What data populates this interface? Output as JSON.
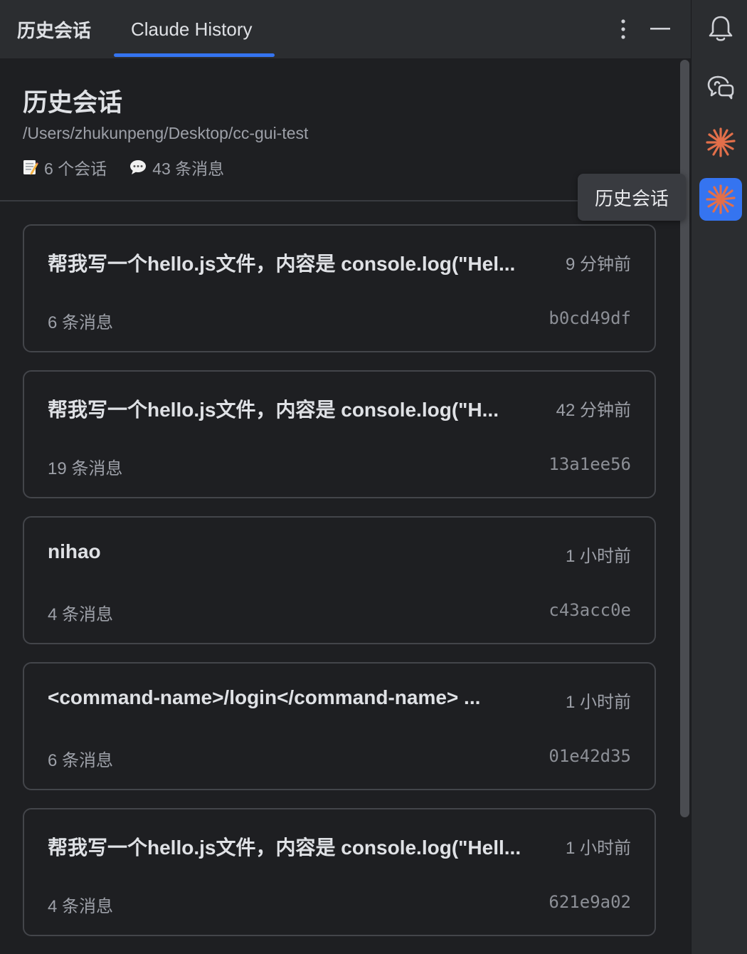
{
  "tabs": [
    {
      "label": "历史会话"
    },
    {
      "label": "Claude History"
    }
  ],
  "header": {
    "title": "历史会话",
    "path": "/Users/zhukunpeng/Desktop/cc-gui-test",
    "sessions_label": "6 个会话",
    "messages_label": "43 条消息"
  },
  "sessions": [
    {
      "title": "帮我写一个hello.js文件，内容是 console.log(\"Hel...",
      "time": "9 分钟前",
      "count": "6 条消息",
      "id": "b0cd49df"
    },
    {
      "title": "帮我写一个hello.js文件，内容是 console.log(\"H...",
      "time": "42 分钟前",
      "count": "19 条消息",
      "id": "13a1ee56"
    },
    {
      "title": "nihao",
      "time": "1 小时前",
      "count": "4 条消息",
      "id": "c43acc0e"
    },
    {
      "title": "<command-name>/login</command-name> ...",
      "time": "1 小时前",
      "count": "6 条消息",
      "id": "01e42d35"
    },
    {
      "title": "帮我写一个hello.js文件，内容是 console.log(\"Hell...",
      "time": "1 小时前",
      "count": "4 条消息",
      "id": "621e9a02"
    }
  ],
  "tooltip": "历史会话",
  "icons": {
    "more": "more-vertical-icon",
    "minimize": "minimize-icon",
    "bell": "bell-icon",
    "chat": "ai-chat-icon",
    "claude": "claude-icon",
    "history": "claude-history-icon",
    "memo": "memo-icon",
    "speech": "speech-bubble-icon"
  },
  "colors": {
    "accent": "#3574f0",
    "claude": "#e26f4a",
    "background": "#1e1f22",
    "toolbar": "#2b2d30"
  }
}
